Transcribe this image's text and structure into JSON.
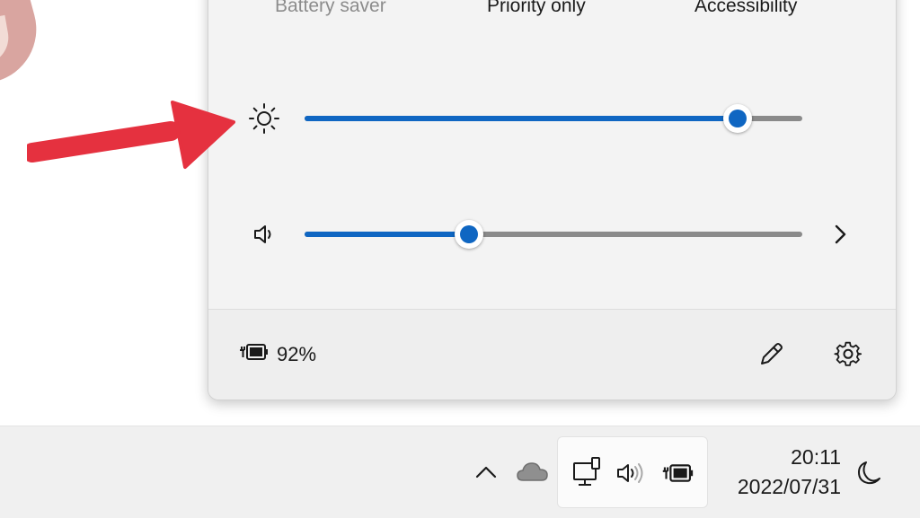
{
  "quick_tiles": [
    {
      "label": "Battery saver",
      "state": "disabled"
    },
    {
      "label": "Priority only",
      "state": "enabled"
    },
    {
      "label": "Accessibility",
      "state": "enabled"
    }
  ],
  "brightness": {
    "icon": "brightness-sun-icon",
    "value_percent": 87
  },
  "volume": {
    "icon": "speaker-icon",
    "value_percent": 33,
    "expand_icon": "chevron-right-icon"
  },
  "footer": {
    "battery_icon": "battery-charging-icon",
    "battery_percent": "92%",
    "edit_icon": "pencil-icon",
    "settings_icon": "gear-icon"
  },
  "annotation": {
    "icon": "red-arrow-icon",
    "color": "#e5313f"
  },
  "taskbar": {
    "overflow_icon": "chevron-up-icon",
    "cloud_icon": "onedrive-cloud-icon",
    "network_icon": "network-wired-icon",
    "volume_icon": "speaker-volume-icon",
    "battery_icon": "battery-charging-icon",
    "time": "20:11",
    "date": "2022/07/31",
    "focus_icon": "moon-icon"
  },
  "colors": {
    "accent": "#0f66c2",
    "track": "#8a8a8a",
    "panel": "#f3f3f3"
  }
}
